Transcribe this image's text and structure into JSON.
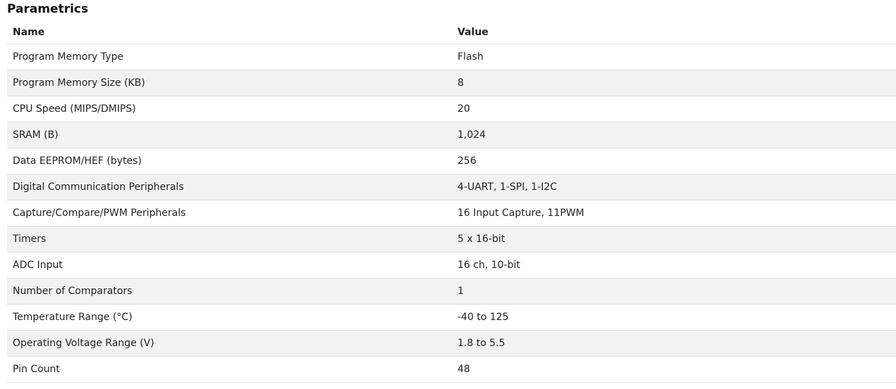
{
  "section": {
    "title": "Parametrics"
  },
  "table": {
    "headers": {
      "name": "Name",
      "value": "Value"
    },
    "rows": [
      {
        "name": "Program Memory Type",
        "value": "Flash"
      },
      {
        "name": "Program Memory Size (KB)",
        "value": "8"
      },
      {
        "name": "CPU Speed (MIPS/DMIPS)",
        "value": "20"
      },
      {
        "name": "SRAM (B)",
        "value": "1,024"
      },
      {
        "name": "Data EEPROM/HEF (bytes)",
        "value": "256"
      },
      {
        "name": "Digital Communication Peripherals",
        "value": "4-UART, 1-SPI, 1-I2C"
      },
      {
        "name": "Capture/Compare/PWM Peripherals",
        "value": "16 Input Capture, 11PWM"
      },
      {
        "name": "Timers",
        "value": "5 x 16-bit"
      },
      {
        "name": "ADC Input",
        "value": "16 ch, 10-bit"
      },
      {
        "name": "Number of Comparators",
        "value": "1"
      },
      {
        "name": "Temperature Range (°C)",
        "value": "-40 to 125"
      },
      {
        "name": "Operating Voltage Range (V)",
        "value": "1.8 to 5.5"
      },
      {
        "name": "Pin Count",
        "value": "48"
      }
    ]
  },
  "colors": {
    "row_stripe": "#f2f2f2",
    "row_border": "#dddddd",
    "text": "#222222"
  }
}
